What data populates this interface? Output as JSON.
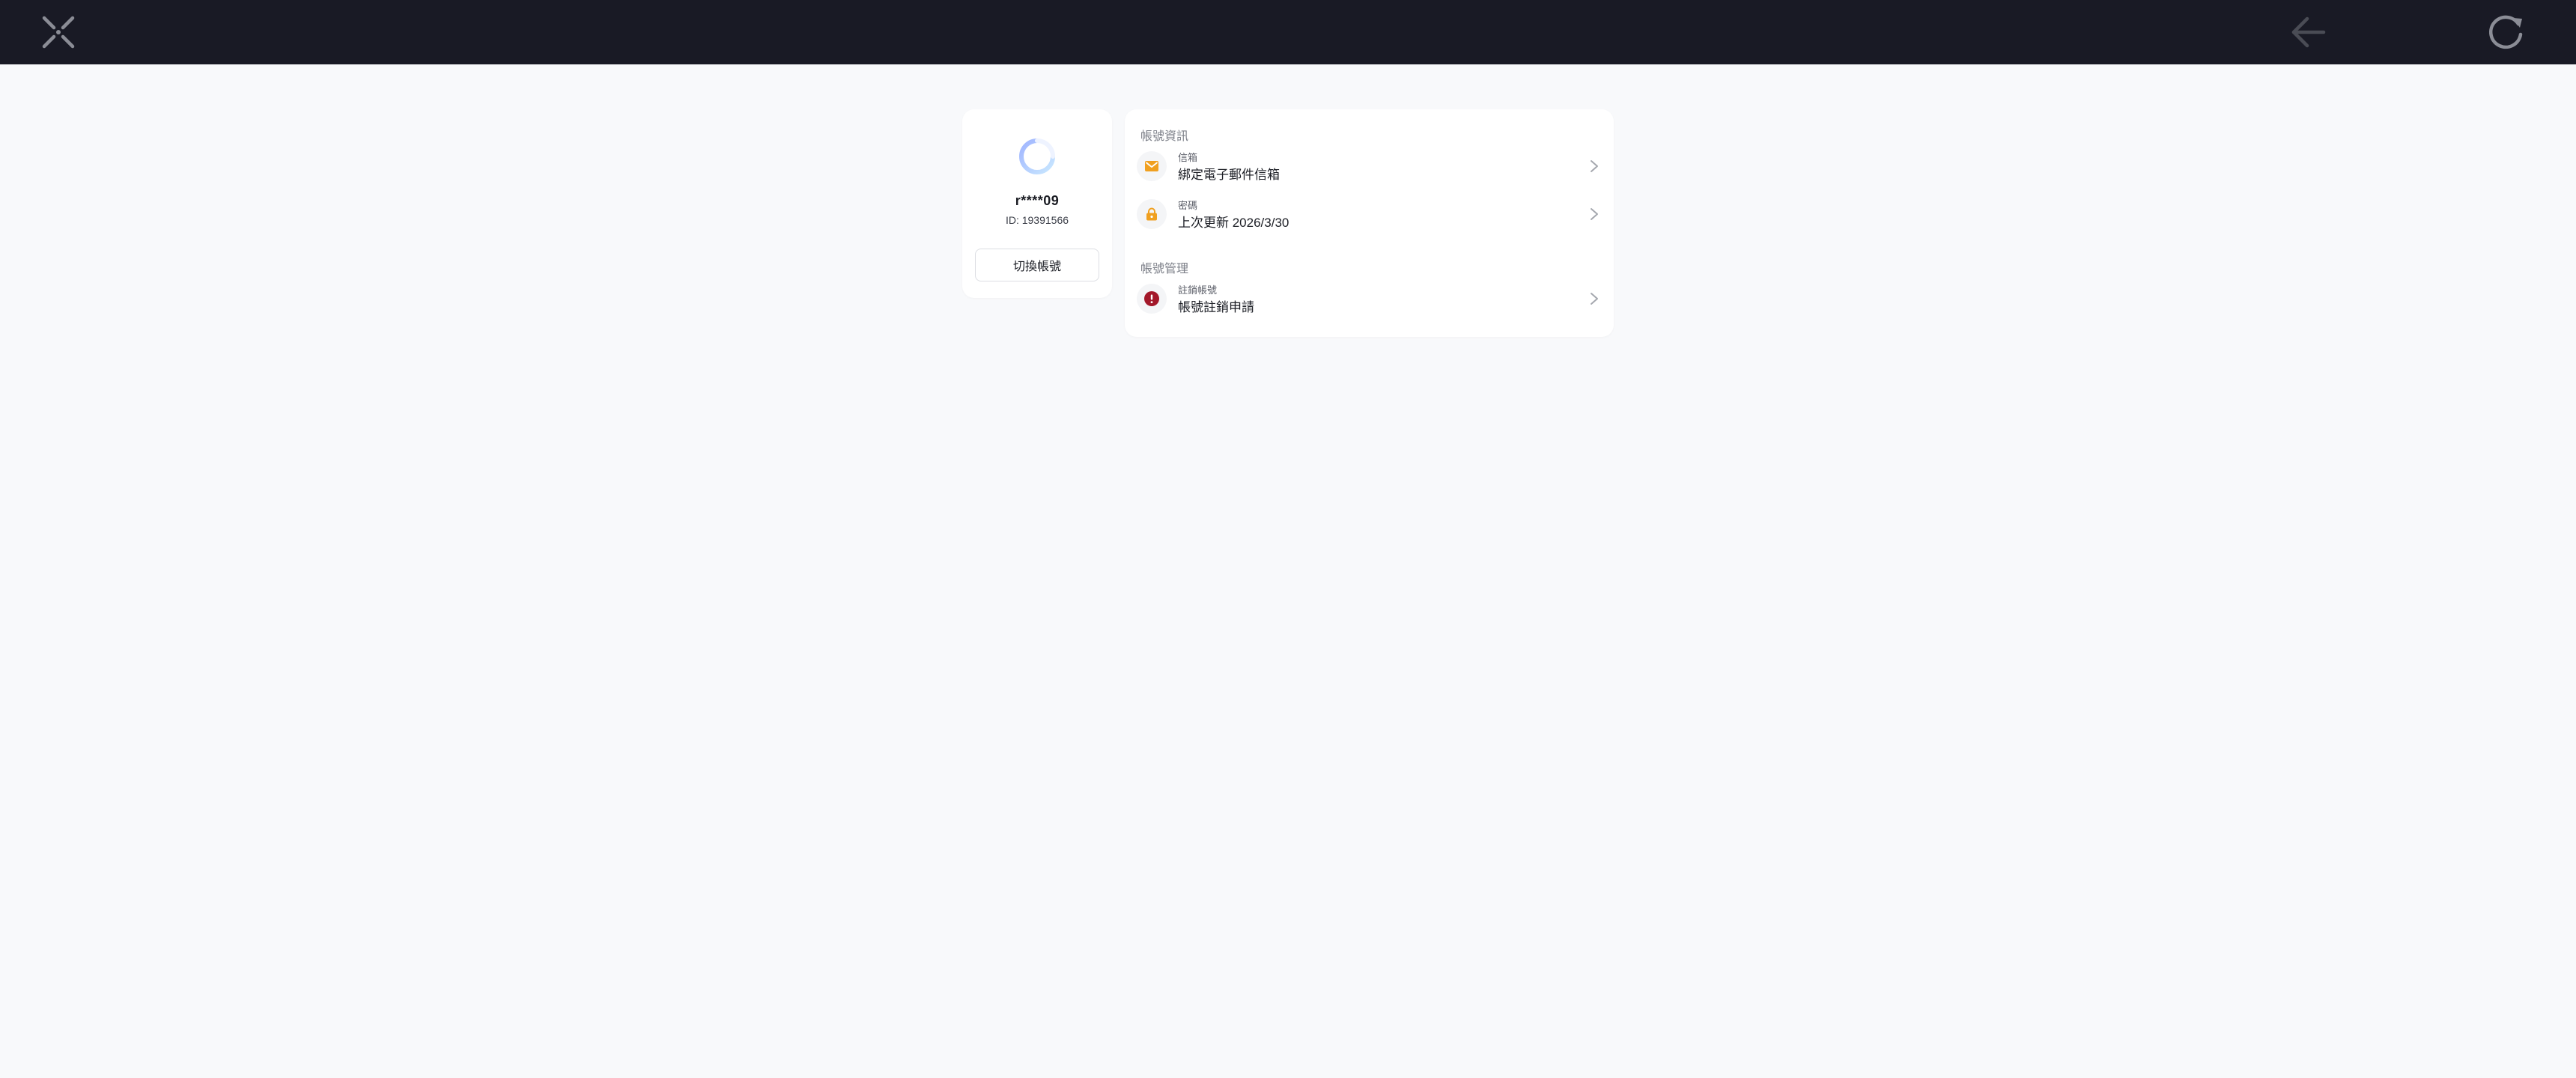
{
  "topbar": {
    "close_icon": "close-x-icon",
    "back_icon": "arrow-left-icon",
    "refresh_icon": "refresh-icon",
    "background": "#191a25"
  },
  "profile": {
    "username": "r****09",
    "user_id": "ID: 19391566",
    "switch_account_label": "切換帳號",
    "avatar_icon": "loading-spinner-icon"
  },
  "account": {
    "info_section_title": "帳號資訊",
    "manage_section_title": "帳號管理",
    "rows": [
      {
        "label": "信箱",
        "value": "綁定電子郵件信箱",
        "icon": "mail-icon",
        "icon_color": "#f0a020"
      },
      {
        "label": "密碼",
        "value": "上次更新 2026/3/30",
        "icon": "lock-icon",
        "icon_color": "#f0a020"
      },
      {
        "label": "註銷帳號",
        "value": "帳號註銷申請",
        "icon": "alert-icon",
        "icon_color": "#a3182a"
      }
    ]
  }
}
